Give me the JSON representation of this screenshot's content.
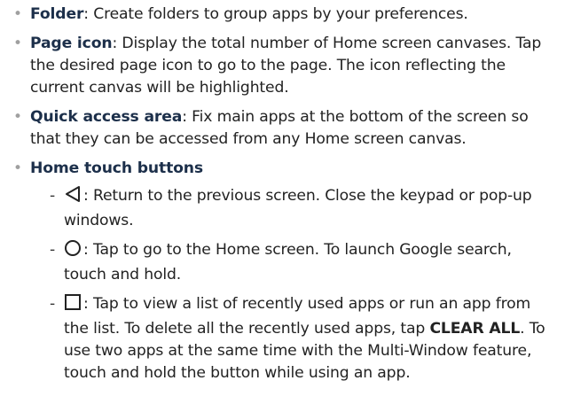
{
  "items": [
    {
      "term": "Folder",
      "text": ": Create folders to group apps by your preferences."
    },
    {
      "term": "Page icon",
      "text": ": Display the total number of Home screen canvases. Tap the desired page icon to go to the page. The icon reflecting the current canvas will be highlighted."
    },
    {
      "term": "Quick access area",
      "text": ": Fix main apps at the bottom of the screen so that they can be accessed from any Home screen canvas."
    },
    {
      "term": "Home touch buttons"
    }
  ],
  "sub_items": [
    {
      "icon": "back-icon",
      "text": ": Return to the previous screen. Close the keypad or pop-up windows."
    },
    {
      "icon": "home-icon",
      "text": ": Tap to go to the Home screen. To launch Google search, touch and hold."
    },
    {
      "icon": "recent-apps-icon",
      "text_before": ": Tap to view a list of recently used apps or run an app from the list. To delete all the recently used apps, tap ",
      "emphasis": "CLEAR ALL",
      "text_after": ". To use two apps at the same time with the Multi-Window feature, touch and hold the button while using an app."
    }
  ],
  "bullet_symbol": "•",
  "dash_symbol": "-",
  "colors": {
    "term": "#1c2f4a",
    "body_text": "#222222",
    "bullet": "#a0a0a0"
  }
}
